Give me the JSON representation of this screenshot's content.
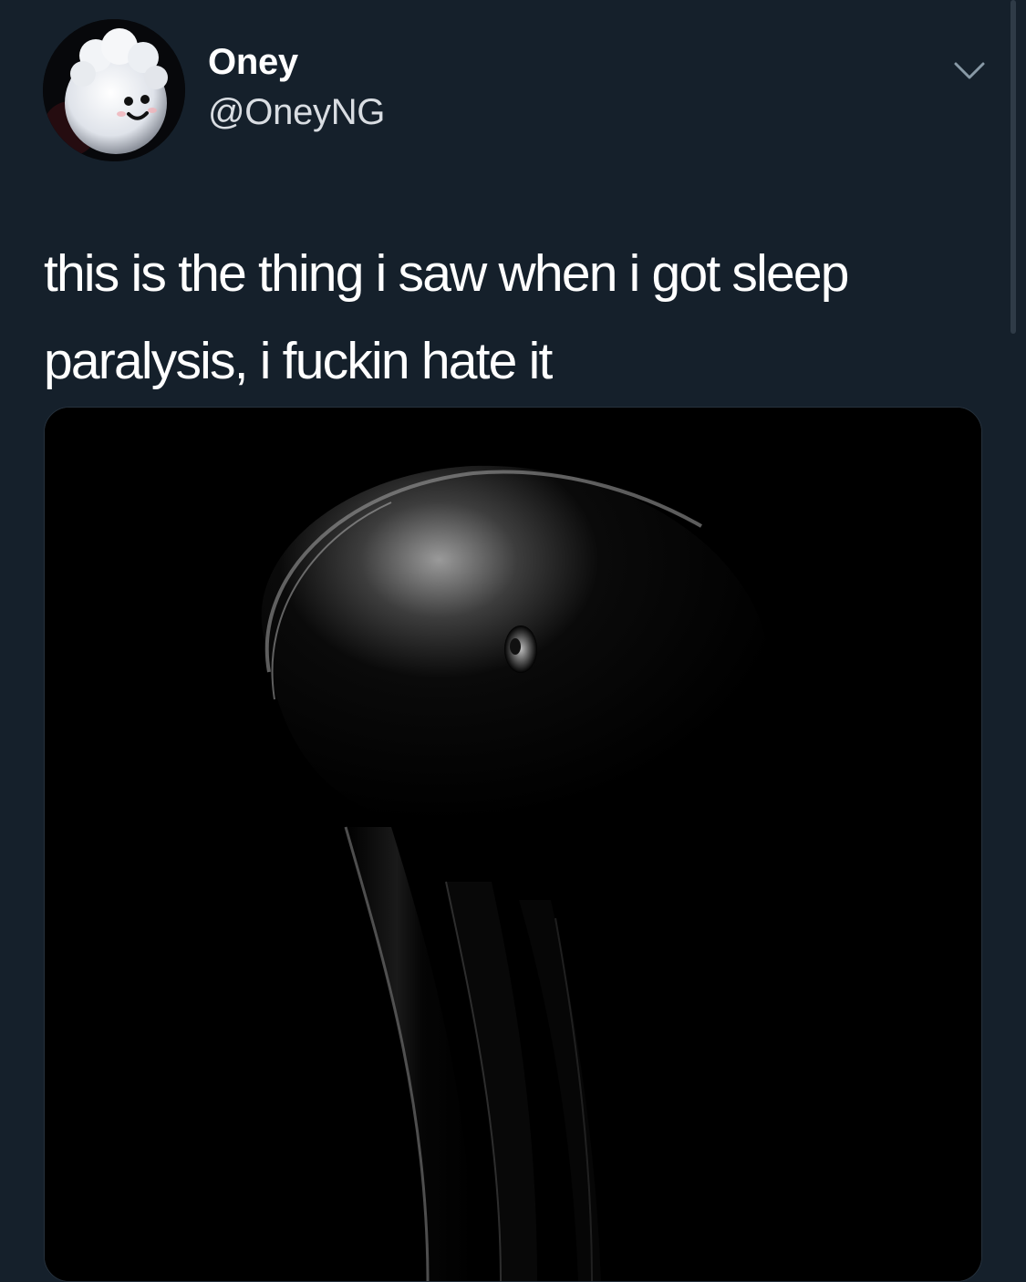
{
  "author": {
    "display_name": "Oney",
    "handle": "@OneyNG",
    "avatar_icon": "avatar-image"
  },
  "header": {
    "more_icon": "chevron-down-icon"
  },
  "tweet": {
    "text": "this is the thing i saw when i got sleep paralysis, i fuckin hate it"
  },
  "media": {
    "kind": "photo"
  },
  "colors": {
    "background": "#15202b",
    "text": "#ffffff",
    "secondary_text": "#d9dde2",
    "icon": "#8899a6"
  }
}
